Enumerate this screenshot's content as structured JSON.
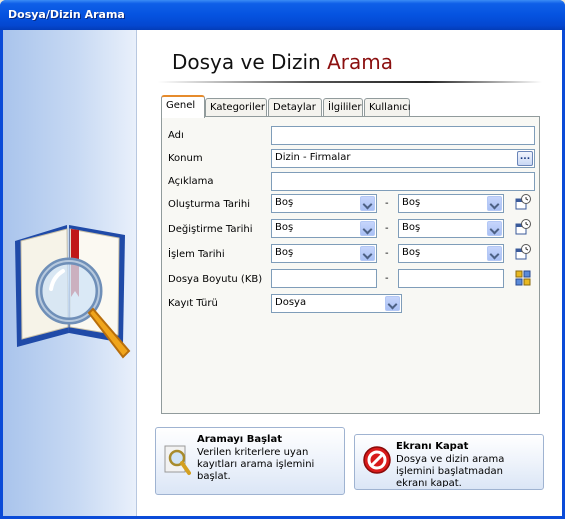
{
  "window": {
    "title": "Dosya/Dizin Arama"
  },
  "header": {
    "title_plain": "Dosya ve Dizin",
    "title_accent": "Arama"
  },
  "tabs": [
    {
      "label": "Genel",
      "active": true
    },
    {
      "label": "Kategoriler",
      "active": false
    },
    {
      "label": "Detaylar",
      "active": false
    },
    {
      "label": "İlgililer",
      "active": false
    },
    {
      "label": "Kullanıcı",
      "active": false
    }
  ],
  "form": {
    "name": {
      "label": "Adı",
      "value": ""
    },
    "location": {
      "label": "Konum",
      "value": "Dizin - Firmalar",
      "browse_label": "..."
    },
    "description": {
      "label": "Açıklama",
      "value": ""
    },
    "created": {
      "label": "Oluşturma Tarihi",
      "from": "Boş",
      "to": "Boş"
    },
    "modified": {
      "label": "Değiştirme Tarihi",
      "from": "Boş",
      "to": "Boş"
    },
    "processed": {
      "label": "İşlem Tarihi",
      "from": "Boş",
      "to": "Boş"
    },
    "size": {
      "label": "Dosya Boyutu (KB)",
      "from": "",
      "to": ""
    },
    "record_type": {
      "label": "Kayıt Türü",
      "value": "Dosya"
    },
    "range_separator": "-"
  },
  "buttons": {
    "start": {
      "title": "Aramayı Başlat",
      "description": "Verilen kriterlere uyan kayıtları arama işlemini başlat."
    },
    "close": {
      "title": "Ekranı Kapat",
      "description": "Dosya ve dizin arama işlemini başlatmadan ekranı kapat."
    }
  },
  "icons": [
    "search-book-icon",
    "calendar-clock-icon",
    "size-units-icon",
    "magnifier-key-icon",
    "stop-sign-icon"
  ],
  "colors": {
    "titlebar": "#0553e0",
    "accent": "#8b1010",
    "active_tab": "#e68b2c"
  }
}
